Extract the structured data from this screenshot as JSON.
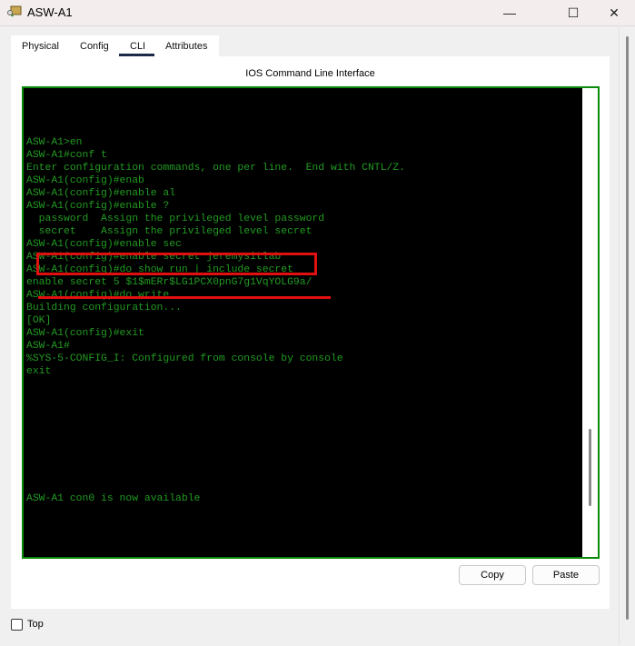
{
  "window": {
    "title": "ASW-A1",
    "minimize": "—",
    "maximize": "☐",
    "close": "✕"
  },
  "tabs": [
    {
      "label": "Physical"
    },
    {
      "label": "Config"
    },
    {
      "label": "CLI"
    },
    {
      "label": "Attributes"
    }
  ],
  "active_tab": "CLI",
  "panel_title": "IOS Command Line Interface",
  "terminal_lines": [
    "",
    "",
    "ASW-A1>en",
    "ASW-A1#conf t",
    "Enter configuration commands, one per line.  End with CNTL/Z.",
    "ASW-A1(config)#enab",
    "ASW-A1(config)#enable al",
    "ASW-A1(config)#enable ?",
    "  password  Assign the privileged level password",
    "  secret    Assign the privileged level secret",
    "ASW-A1(config)#enable sec",
    "ASW-A1(config)#enable secret jeremysitlab",
    "ASW-A1(config)#do show run | include secret",
    "enable secret 5 $1$mERr$LG1PCX0pnG7g1VqYOLG9a/",
    "ASW-A1(config)#do write",
    "Building configuration...",
    "[OK]",
    "ASW-A1(config)#exit",
    "ASW-A1#",
    "%SYS-5-CONFIG_I: Configured from console by console",
    "exit",
    "",
    "",
    "",
    "",
    "",
    "",
    "",
    "",
    "",
    "ASW-A1 con0 is now available"
  ],
  "buttons": {
    "copy": "Copy",
    "paste": "Paste"
  },
  "top_checkbox": {
    "label": "Top",
    "checked": false
  },
  "colors": {
    "terminal_text": "#229a22",
    "terminal_border": "#0a8a0a",
    "highlight": "#e01010"
  }
}
